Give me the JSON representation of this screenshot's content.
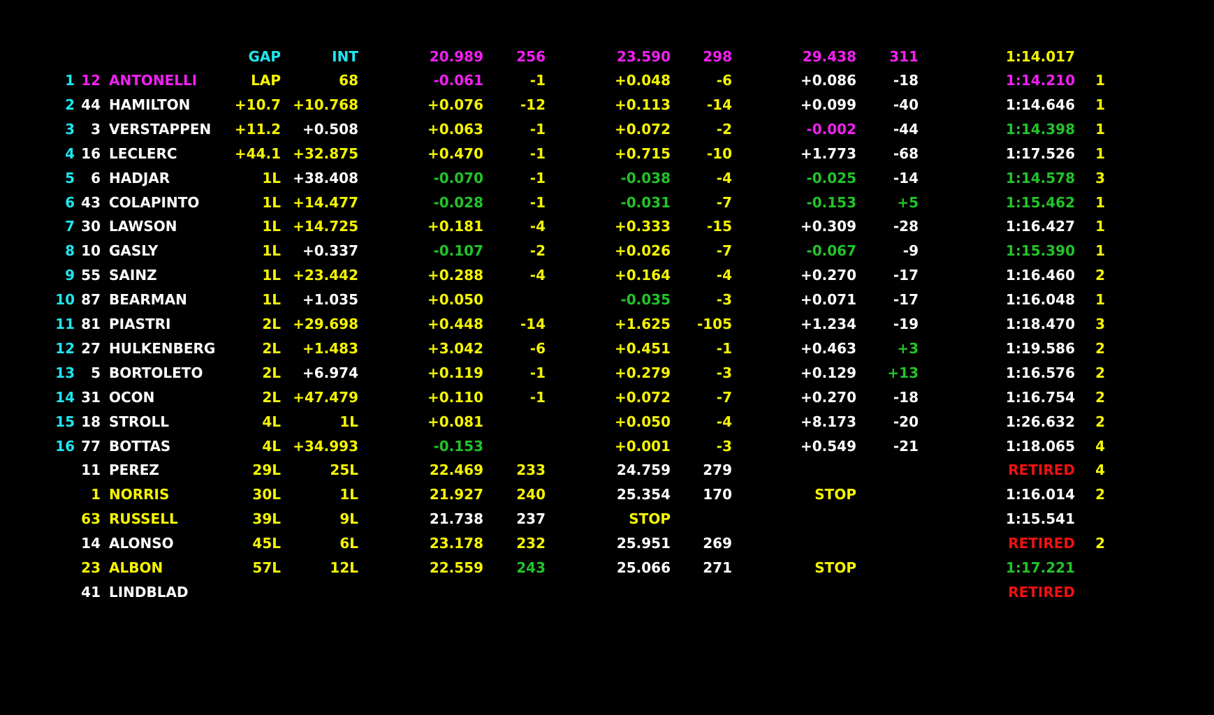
{
  "colors": {
    "cyan": "#1ee6f0",
    "yellow": "#f5f500",
    "white": "#ffffff",
    "green": "#22c32a",
    "magenta": "#f020f0",
    "red": "#ee1111"
  },
  "header": {
    "gap_label": "GAP",
    "int_label": "INT",
    "s1_best": "20.989",
    "s1_speed": "256",
    "s2_best": "23.590",
    "s2_speed": "298",
    "s3_best": "29.438",
    "s3_speed": "311",
    "best_lap": "1:14.017"
  },
  "rows": [
    {
      "pos": "1",
      "num": "12",
      "name": "ANTONELLI",
      "gap": "LAP",
      "int": "68",
      "s1": "-0.061",
      "s1p": "-1",
      "s2": "+0.048",
      "s2p": "-6",
      "s3": "+0.086",
      "s3p": "-18",
      "lap": "1:14.210",
      "pit": "1",
      "c": {
        "pos": "cyan",
        "num": "magenta",
        "name": "magenta",
        "gap": "yellow",
        "int": "yellow",
        "s1": "magenta",
        "s1p": "yellow",
        "s2": "yellow",
        "s2p": "yellow",
        "s3": "white",
        "s3p": "white",
        "lap": "magenta",
        "pit": "yellow"
      }
    },
    {
      "pos": "2",
      "num": "44",
      "name": "HAMILTON",
      "gap": "+10.7",
      "int": "+10.768",
      "s1": "+0.076",
      "s1p": "-12",
      "s2": "+0.113",
      "s2p": "-14",
      "s3": "+0.099",
      "s3p": "-40",
      "lap": "1:14.646",
      "pit": "1",
      "c": {
        "pos": "cyan",
        "num": "white",
        "name": "white",
        "gap": "yellow",
        "int": "yellow",
        "s1": "yellow",
        "s1p": "yellow",
        "s2": "yellow",
        "s2p": "yellow",
        "s3": "white",
        "s3p": "white",
        "lap": "white",
        "pit": "yellow"
      }
    },
    {
      "pos": "3",
      "num": "3",
      "name": "VERSTAPPEN",
      "gap": "+11.2",
      "int": "+0.508",
      "s1": "+0.063",
      "s1p": "-1",
      "s2": "+0.072",
      "s2p": "-2",
      "s3": "-0.002",
      "s3p": "-44",
      "lap": "1:14.398",
      "pit": "1",
      "c": {
        "pos": "cyan",
        "num": "white",
        "name": "white",
        "gap": "yellow",
        "int": "white",
        "s1": "yellow",
        "s1p": "yellow",
        "s2": "yellow",
        "s2p": "yellow",
        "s3": "magenta",
        "s3p": "white",
        "lap": "green",
        "pit": "yellow"
      }
    },
    {
      "pos": "4",
      "num": "16",
      "name": "LECLERC",
      "gap": "+44.1",
      "int": "+32.875",
      "s1": "+0.470",
      "s1p": "-1",
      "s2": "+0.715",
      "s2p": "-10",
      "s3": "+1.773",
      "s3p": "-68",
      "lap": "1:17.526",
      "pit": "1",
      "c": {
        "pos": "cyan",
        "num": "white",
        "name": "white",
        "gap": "yellow",
        "int": "yellow",
        "s1": "yellow",
        "s1p": "yellow",
        "s2": "yellow",
        "s2p": "yellow",
        "s3": "white",
        "s3p": "white",
        "lap": "white",
        "pit": "yellow"
      }
    },
    {
      "pos": "5",
      "num": "6",
      "name": "HADJAR",
      "gap": "1L",
      "int": "+38.408",
      "s1": "-0.070",
      "s1p": "-1",
      "s2": "-0.038",
      "s2p": "-4",
      "s3": "-0.025",
      "s3p": "-14",
      "lap": "1:14.578",
      "pit": "3",
      "c": {
        "pos": "cyan",
        "num": "white",
        "name": "white",
        "gap": "yellow",
        "int": "white",
        "s1": "green",
        "s1p": "yellow",
        "s2": "green",
        "s2p": "yellow",
        "s3": "green",
        "s3p": "white",
        "lap": "green",
        "pit": "yellow"
      }
    },
    {
      "pos": "6",
      "num": "43",
      "name": "COLAPINTO",
      "gap": "1L",
      "int": "+14.477",
      "s1": "-0.028",
      "s1p": "-1",
      "s2": "-0.031",
      "s2p": "-7",
      "s3": "-0.153",
      "s3p": "+5",
      "lap": "1:15.462",
      "pit": "1",
      "c": {
        "pos": "cyan",
        "num": "white",
        "name": "white",
        "gap": "yellow",
        "int": "yellow",
        "s1": "green",
        "s1p": "yellow",
        "s2": "green",
        "s2p": "yellow",
        "s3": "green",
        "s3p": "green",
        "lap": "green",
        "pit": "yellow"
      }
    },
    {
      "pos": "7",
      "num": "30",
      "name": "LAWSON",
      "gap": "1L",
      "int": "+14.725",
      "s1": "+0.181",
      "s1p": "-4",
      "s2": "+0.333",
      "s2p": "-15",
      "s3": "+0.309",
      "s3p": "-28",
      "lap": "1:16.427",
      "pit": "1",
      "c": {
        "pos": "cyan",
        "num": "white",
        "name": "white",
        "gap": "yellow",
        "int": "yellow",
        "s1": "yellow",
        "s1p": "yellow",
        "s2": "yellow",
        "s2p": "yellow",
        "s3": "white",
        "s3p": "white",
        "lap": "white",
        "pit": "yellow"
      }
    },
    {
      "pos": "8",
      "num": "10",
      "name": "GASLY",
      "gap": "1L",
      "int": "+0.337",
      "s1": "-0.107",
      "s1p": "-2",
      "s2": "+0.026",
      "s2p": "-7",
      "s3": "-0.067",
      "s3p": "-9",
      "lap": "1:15.390",
      "pit": "1",
      "c": {
        "pos": "cyan",
        "num": "white",
        "name": "white",
        "gap": "yellow",
        "int": "white",
        "s1": "green",
        "s1p": "yellow",
        "s2": "yellow",
        "s2p": "yellow",
        "s3": "green",
        "s3p": "white",
        "lap": "green",
        "pit": "yellow"
      }
    },
    {
      "pos": "9",
      "num": "55",
      "name": "SAINZ",
      "gap": "1L",
      "int": "+23.442",
      "s1": "+0.288",
      "s1p": "-4",
      "s2": "+0.164",
      "s2p": "-4",
      "s3": "+0.270",
      "s3p": "-17",
      "lap": "1:16.460",
      "pit": "2",
      "c": {
        "pos": "cyan",
        "num": "white",
        "name": "white",
        "gap": "yellow",
        "int": "yellow",
        "s1": "yellow",
        "s1p": "yellow",
        "s2": "yellow",
        "s2p": "yellow",
        "s3": "white",
        "s3p": "white",
        "lap": "white",
        "pit": "yellow"
      }
    },
    {
      "pos": "10",
      "num": "87",
      "name": "BEARMAN",
      "gap": "1L",
      "int": "+1.035",
      "s1": "+0.050",
      "s1p": "",
      "s2": "-0.035",
      "s2p": "-3",
      "s3": "+0.071",
      "s3p": "-17",
      "lap": "1:16.048",
      "pit": "1",
      "c": {
        "pos": "cyan",
        "num": "white",
        "name": "white",
        "gap": "yellow",
        "int": "white",
        "s1": "yellow",
        "s1p": "yellow",
        "s2": "green",
        "s2p": "yellow",
        "s3": "white",
        "s3p": "white",
        "lap": "white",
        "pit": "yellow"
      }
    },
    {
      "pos": "11",
      "num": "81",
      "name": "PIASTRI",
      "gap": "2L",
      "int": "+29.698",
      "s1": "+0.448",
      "s1p": "-14",
      "s2": "+1.625",
      "s2p": "-105",
      "s3": "+1.234",
      "s3p": "-19",
      "lap": "1:18.470",
      "pit": "3",
      "c": {
        "pos": "cyan",
        "num": "white",
        "name": "white",
        "gap": "yellow",
        "int": "yellow",
        "s1": "yellow",
        "s1p": "yellow",
        "s2": "yellow",
        "s2p": "yellow",
        "s3": "white",
        "s3p": "white",
        "lap": "white",
        "pit": "yellow"
      }
    },
    {
      "pos": "12",
      "num": "27",
      "name": "HULKENBERG",
      "gap": "2L",
      "int": "+1.483",
      "s1": "+3.042",
      "s1p": "-6",
      "s2": "+0.451",
      "s2p": "-1",
      "s3": "+0.463",
      "s3p": "+3",
      "lap": "1:19.586",
      "pit": "2",
      "c": {
        "pos": "cyan",
        "num": "white",
        "name": "white",
        "gap": "yellow",
        "int": "yellow",
        "s1": "yellow",
        "s1p": "yellow",
        "s2": "yellow",
        "s2p": "yellow",
        "s3": "white",
        "s3p": "green",
        "lap": "white",
        "pit": "yellow"
      }
    },
    {
      "pos": "13",
      "num": "5",
      "name": "BORTOLETO",
      "gap": "2L",
      "int": "+6.974",
      "s1": "+0.119",
      "s1p": "-1",
      "s2": "+0.279",
      "s2p": "-3",
      "s3": "+0.129",
      "s3p": "+13",
      "lap": "1:16.576",
      "pit": "2",
      "c": {
        "pos": "cyan",
        "num": "white",
        "name": "white",
        "gap": "yellow",
        "int": "white",
        "s1": "yellow",
        "s1p": "yellow",
        "s2": "yellow",
        "s2p": "yellow",
        "s3": "white",
        "s3p": "green",
        "lap": "white",
        "pit": "yellow"
      }
    },
    {
      "pos": "14",
      "num": "31",
      "name": "OCON",
      "gap": "2L",
      "int": "+47.479",
      "s1": "+0.110",
      "s1p": "-1",
      "s2": "+0.072",
      "s2p": "-7",
      "s3": "+0.270",
      "s3p": "-18",
      "lap": "1:16.754",
      "pit": "2",
      "c": {
        "pos": "cyan",
        "num": "white",
        "name": "white",
        "gap": "yellow",
        "int": "yellow",
        "s1": "yellow",
        "s1p": "yellow",
        "s2": "yellow",
        "s2p": "yellow",
        "s3": "white",
        "s3p": "white",
        "lap": "white",
        "pit": "yellow"
      }
    },
    {
      "pos": "15",
      "num": "18",
      "name": "STROLL",
      "gap": "4L",
      "int": "1L",
      "s1": "+0.081",
      "s1p": "",
      "s2": "+0.050",
      "s2p": "-4",
      "s3": "+8.173",
      "s3p": "-20",
      "lap": "1:26.632",
      "pit": "2",
      "c": {
        "pos": "cyan",
        "num": "white",
        "name": "white",
        "gap": "yellow",
        "int": "yellow",
        "s1": "yellow",
        "s1p": "yellow",
        "s2": "yellow",
        "s2p": "yellow",
        "s3": "white",
        "s3p": "white",
        "lap": "white",
        "pit": "yellow"
      }
    },
    {
      "pos": "16",
      "num": "77",
      "name": "BOTTAS",
      "gap": "4L",
      "int": "+34.993",
      "s1": "-0.153",
      "s1p": "",
      "s2": "+0.001",
      "s2p": "-3",
      "s3": "+0.549",
      "s3p": "-21",
      "lap": "1:18.065",
      "pit": "4",
      "c": {
        "pos": "cyan",
        "num": "white",
        "name": "white",
        "gap": "yellow",
        "int": "yellow",
        "s1": "green",
        "s1p": "yellow",
        "s2": "yellow",
        "s2p": "yellow",
        "s3": "white",
        "s3p": "white",
        "lap": "white",
        "pit": "yellow"
      }
    },
    {
      "pos": "",
      "num": "11",
      "name": "PEREZ",
      "gap": "29L",
      "int": "25L",
      "s1": "22.469",
      "s1p": "233",
      "s2": "24.759",
      "s2p": "279",
      "s3": "",
      "s3p": "",
      "lap": "RETIRED",
      "pit": "4",
      "c": {
        "pos": "cyan",
        "num": "white",
        "name": "white",
        "gap": "yellow",
        "int": "yellow",
        "s1": "yellow",
        "s1p": "yellow",
        "s2": "white",
        "s2p": "white",
        "s3": "white",
        "s3p": "white",
        "lap": "red",
        "pit": "yellow"
      }
    },
    {
      "pos": "",
      "num": "1",
      "name": "NORRIS",
      "gap": "30L",
      "int": "1L",
      "s1": "21.927",
      "s1p": "240",
      "s2": "25.354",
      "s2p": "170",
      "s3": "STOP",
      "s3p": "",
      "lap": "1:16.014",
      "pit": "2",
      "c": {
        "pos": "cyan",
        "num": "yellow",
        "name": "yellow",
        "gap": "yellow",
        "int": "yellow",
        "s1": "yellow",
        "s1p": "yellow",
        "s2": "white",
        "s2p": "white",
        "s3": "yellow",
        "s3p": "white",
        "lap": "white",
        "pit": "yellow"
      }
    },
    {
      "pos": "",
      "num": "63",
      "name": "RUSSELL",
      "gap": "39L",
      "int": "9L",
      "s1": "21.738",
      "s1p": "237",
      "s2": "STOP",
      "s2p": "",
      "s3": "",
      "s3p": "",
      "lap": "1:15.541",
      "pit": "",
      "c": {
        "pos": "cyan",
        "num": "yellow",
        "name": "yellow",
        "gap": "yellow",
        "int": "yellow",
        "s1": "white",
        "s1p": "white",
        "s2": "yellow",
        "s2p": "white",
        "s3": "white",
        "s3p": "white",
        "lap": "white",
        "pit": "yellow"
      }
    },
    {
      "pos": "",
      "num": "14",
      "name": "ALONSO",
      "gap": "45L",
      "int": "6L",
      "s1": "23.178",
      "s1p": "232",
      "s2": "25.951",
      "s2p": "269",
      "s3": "",
      "s3p": "",
      "lap": "RETIRED",
      "pit": "2",
      "c": {
        "pos": "cyan",
        "num": "white",
        "name": "white",
        "gap": "yellow",
        "int": "yellow",
        "s1": "yellow",
        "s1p": "yellow",
        "s2": "white",
        "s2p": "white",
        "s3": "white",
        "s3p": "white",
        "lap": "red",
        "pit": "yellow"
      }
    },
    {
      "pos": "",
      "num": "23",
      "name": "ALBON",
      "gap": "57L",
      "int": "12L",
      "s1": "22.559",
      "s1p": "243",
      "s2": "25.066",
      "s2p": "271",
      "s3": "STOP",
      "s3p": "",
      "lap": "1:17.221",
      "pit": "",
      "c": {
        "pos": "cyan",
        "num": "yellow",
        "name": "yellow",
        "gap": "yellow",
        "int": "yellow",
        "s1": "yellow",
        "s1p": "green",
        "s2": "white",
        "s2p": "white",
        "s3": "yellow",
        "s3p": "white",
        "lap": "green",
        "pit": "yellow"
      }
    },
    {
      "pos": "",
      "num": "41",
      "name": "LINDBLAD",
      "gap": "",
      "int": "",
      "s1": "",
      "s1p": "",
      "s2": "",
      "s2p": "",
      "s3": "",
      "s3p": "",
      "lap": "RETIRED",
      "pit": "",
      "c": {
        "pos": "cyan",
        "num": "white",
        "name": "white",
        "gap": "yellow",
        "int": "yellow",
        "s1": "yellow",
        "s1p": "yellow",
        "s2": "white",
        "s2p": "white",
        "s3": "white",
        "s3p": "white",
        "lap": "red",
        "pit": "yellow"
      }
    }
  ]
}
